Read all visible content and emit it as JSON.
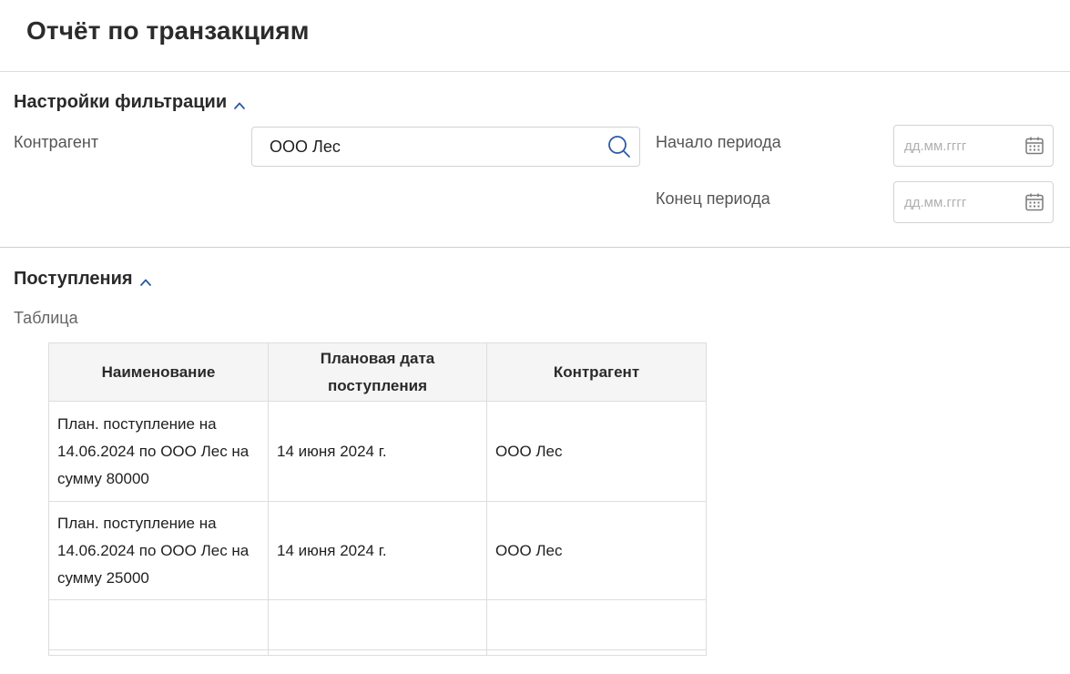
{
  "page": {
    "title": "Отчёт по транзакциям"
  },
  "filters": {
    "title": "Настройки фильтрации",
    "counterparty_label": "Контрагент",
    "counterparty_value": "ООО Лес",
    "period_start_label": "Начало периода",
    "period_start_placeholder": "дд.мм.гггг",
    "period_end_label": "Конец периода",
    "period_end_placeholder": "дд.мм.гггг"
  },
  "receipts": {
    "title": "Поступления",
    "table_label": "Таблица",
    "columns": [
      "Наименование",
      "Плановая дата поступления",
      "Контрагент"
    ],
    "rows": [
      {
        "name": "План. поступление на 14.06.2024 по ООО Лес на сумму 80000",
        "date": "14 июня 2024 г.",
        "counterparty": "ООО Лес"
      },
      {
        "name": "План. поступление на 14.06.2024 по ООО Лес на сумму 25000",
        "date": "14 июня 2024 г.",
        "counterparty": "ООО Лес"
      }
    ]
  },
  "icons": {
    "search": "search-icon",
    "calendar": "calendar-icon",
    "collapse": "chevron-up-icon"
  },
  "colors": {
    "accent": "#2b5aa6",
    "border": "#d3d3d3",
    "header_bg": "#f5f5f5"
  }
}
